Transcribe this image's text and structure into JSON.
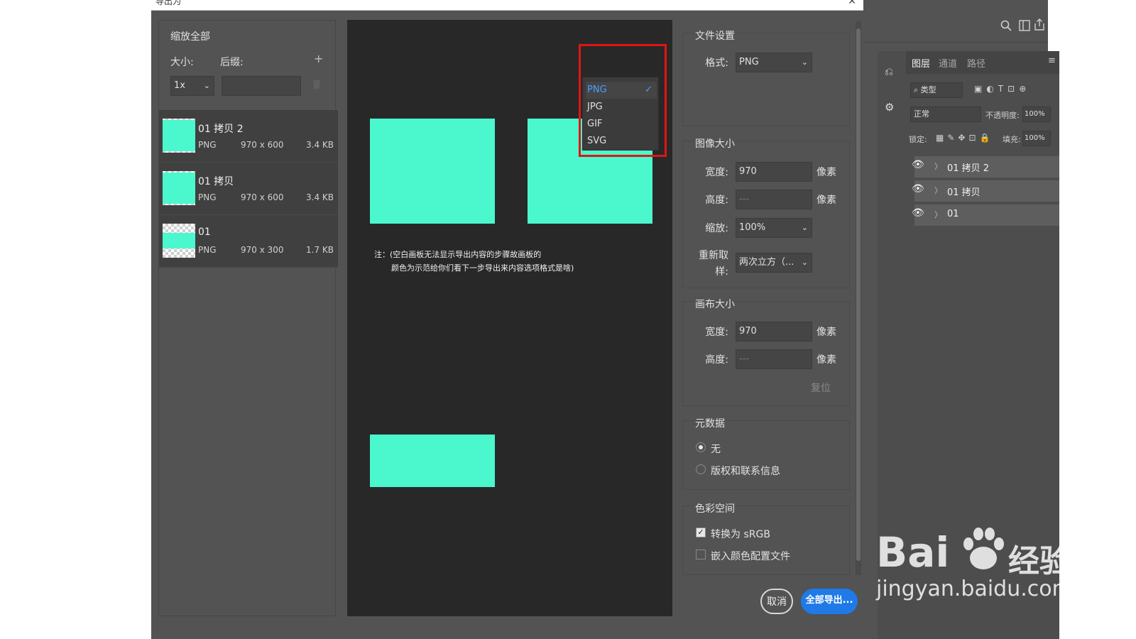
{
  "dialog": {
    "title": "导出为",
    "close_icon": "close-icon"
  },
  "left": {
    "section_title": "缩放全部",
    "size_label": "大小:",
    "suffix_label": "后缀:",
    "scale_value": "1x",
    "suffix_value": "",
    "add_icon": "+",
    "assets": [
      {
        "name": "01 拷贝 2",
        "format": "PNG",
        "dims": "970 x 600",
        "size": "3.4 KB",
        "fill_fraction": 0.92
      },
      {
        "name": "01 拷贝",
        "format": "PNG",
        "dims": "970 x 600",
        "size": "3.4 KB",
        "fill_fraction": 0.92
      },
      {
        "name": "01",
        "format": "PNG",
        "dims": "970 x 300",
        "size": "1.7 KB",
        "fill_fraction": 0.45
      }
    ]
  },
  "preview": {
    "note_line1": "注：(空白画板无法显示导出内容的步骤故画板的",
    "note_line2": "颜色为示范给你们看下一步导出来内容选项格式是啥)",
    "artboard_color": "#4bf7cd"
  },
  "settings": {
    "file_settings_title": "文件设置",
    "format_label": "格式:",
    "format_value": "PNG",
    "format_options": [
      "PNG",
      "JPG",
      "GIF",
      "SVG"
    ],
    "format_selected": "PNG",
    "image_size_title": "图像大小",
    "width_label": "宽度:",
    "width_value": "970",
    "height_label": "高度:",
    "height_placeholder": "---",
    "unit": "像素",
    "scale_label": "缩放:",
    "scale_value": "100%",
    "resample_label_1": "重新取",
    "resample_label_2": "样:",
    "resample_value": "两次立方（...",
    "canvas_size_title": "画布大小",
    "canvas_width_value": "970",
    "canvas_height_placeholder": "---",
    "reset_label": "复位",
    "metadata_title": "元数据",
    "metadata_none": "无",
    "metadata_copyright": "版权和联系信息",
    "colorspace_title": "色彩空间",
    "convert_srgb": "转换为 sRGB",
    "embed_profile": "嵌入颜色配置文件"
  },
  "buttons": {
    "cancel": "取消",
    "export_all": "全部导出..."
  },
  "layers": {
    "tabs": [
      "图层",
      "通道",
      "路径"
    ],
    "filter_label": "类型",
    "blend_mode": "正常",
    "opacity_label": "不透明度:",
    "opacity_value": "100%",
    "lock_label": "锁定:",
    "fill_label": "填充:",
    "fill_value": "100%",
    "rows": [
      "01 拷贝 2",
      "01 拷贝",
      "01"
    ]
  },
  "watermark": {
    "brand": "Bai",
    "brand_cn": "经验",
    "url": "jingyan.baidu.com"
  },
  "colors": {
    "accent_blue": "#1f7ae8",
    "highlight_red": "#e01515",
    "artboard": "#4bf7cd"
  }
}
